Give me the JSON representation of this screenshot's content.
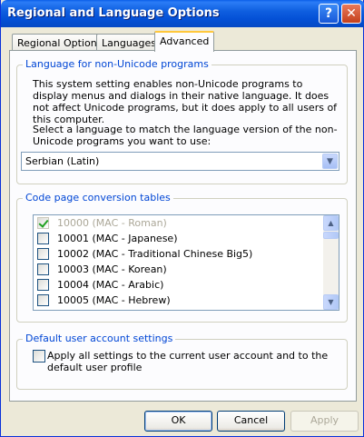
{
  "window": {
    "title": "Regional and Language Options",
    "help_label": "?",
    "close_label": "✕"
  },
  "tabs": [
    {
      "label": "Regional Options"
    },
    {
      "label": "Languages"
    },
    {
      "label": "Advanced"
    }
  ],
  "non_unicode": {
    "group_title": "Language for non-Unicode programs",
    "description": "This system setting enables non-Unicode programs to display menus and dialogs in their native language. It does not affect Unicode programs, but it does apply to all users of this computer.",
    "instruction": "Select a language to match the language version of the non-Unicode programs you want to use:",
    "selected_language": "Serbian (Latin)",
    "dropdown_icon": "chevron-down-icon"
  },
  "code_page": {
    "group_title": "Code page conversion tables",
    "items": [
      {
        "label": "10000 (MAC - Roman)",
        "checked": true,
        "disabled": true
      },
      {
        "label": "10001 (MAC - Japanese)",
        "checked": false,
        "disabled": false
      },
      {
        "label": "10002 (MAC - Traditional Chinese Big5)",
        "checked": false,
        "disabled": false
      },
      {
        "label": "10003 (MAC - Korean)",
        "checked": false,
        "disabled": false
      },
      {
        "label": "10004 (MAC - Arabic)",
        "checked": false,
        "disabled": false
      },
      {
        "label": "10005 (MAC - Hebrew)",
        "checked": false,
        "disabled": false
      }
    ]
  },
  "default_user": {
    "group_title": "Default user account settings",
    "checkbox_label": "Apply all settings to the current user account and to the default user profile",
    "checked": false
  },
  "buttons": {
    "ok": "OK",
    "cancel": "Cancel",
    "apply": "Apply"
  },
  "colors": {
    "title_bar": "#0a5ee8",
    "group_title": "#0046d5",
    "face": "#ece9d8"
  }
}
